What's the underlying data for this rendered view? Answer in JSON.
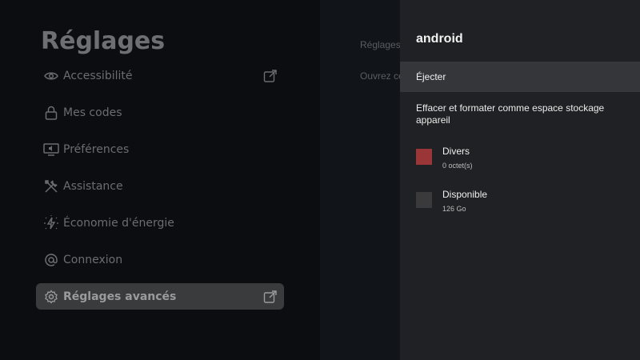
{
  "background": {
    "title": "Réglages",
    "breadcrumb_top": "Réglages",
    "breadcrumb_sub": "Ouvrez ce",
    "menu": [
      {
        "label": "Accessibilité",
        "icon": "eye-icon"
      },
      {
        "label": "Mes codes",
        "icon": "lock-icon"
      },
      {
        "label": "Préférences",
        "icon": "tv-sound-icon"
      },
      {
        "label": "Assistance",
        "icon": "tools-icon"
      },
      {
        "label": "Économie d'énergie",
        "icon": "energy-icon"
      },
      {
        "label": "Connexion",
        "icon": "at-icon"
      },
      {
        "label": "Réglages avancés",
        "icon": "gear-icon"
      }
    ]
  },
  "panel": {
    "title": "android",
    "eject_label": "Éjecter",
    "format_label": "Effacer et formater comme espace stockage appareil",
    "storage": [
      {
        "name": "Divers",
        "value": "0 octet(s)",
        "color": "#9a3638"
      },
      {
        "name": "Disponible",
        "value": "126 Go",
        "color": "#3a3a3c"
      }
    ]
  },
  "colors": {
    "panel_bg": "#202124",
    "selected_row_bg": "#35363a",
    "active_menu_bg": "#3a3b3d"
  }
}
